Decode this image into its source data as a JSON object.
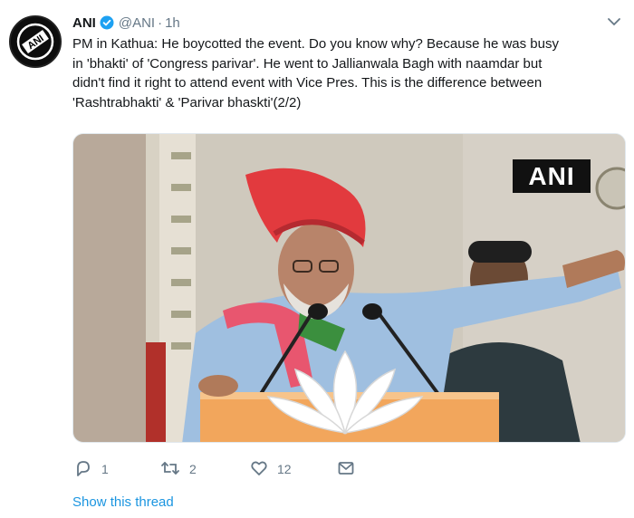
{
  "tweet": {
    "author_name": "ANI",
    "handle": "@ANI",
    "separator": "·",
    "time": "1h",
    "avatar_text": "ANI",
    "text_lines": [
      "PM in Kathua: He boycotted the event. Do you know why? Because he was busy",
      "in 'bhakti' of 'Congress parivar'. He went to Jallianwala Bagh with naamdar but",
      "didn't find it right to attend event with Vice Pres. This is the difference between",
      "'Rashtrabhakti' & 'Parivar bhaskti'(2/2)"
    ],
    "media_watermark": "ANI"
  },
  "actions": {
    "reply_count": "1",
    "retweet_count": "2",
    "like_count": "12"
  },
  "show_thread_label": "Show this thread",
  "colors": {
    "accent": "#1da1f2",
    "link": "#1b95e0",
    "muted": "#657786",
    "text": "#14171a"
  },
  "icons": [
    "verified-badge-icon",
    "caret-down-icon",
    "reply-icon",
    "retweet-icon",
    "like-icon",
    "direct-message-icon"
  ]
}
